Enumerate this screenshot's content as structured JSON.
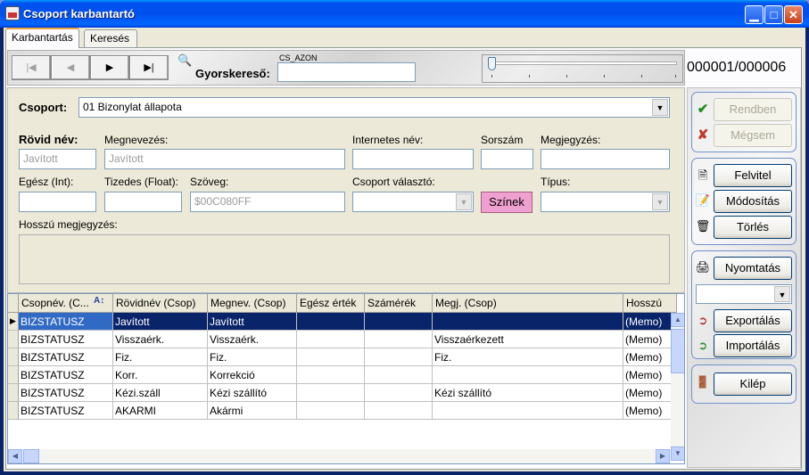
{
  "window": {
    "title": "Csoport karbantartó"
  },
  "tabs": [
    {
      "label": "Karbantartás"
    },
    {
      "label": "Keresés"
    }
  ],
  "nav": {
    "first": "|◀",
    "prev": "◀",
    "next": "▶",
    "last": "▶|",
    "quick_search_label": "Gyorskereső:",
    "quick_search_field_caption": "CS_AZON",
    "quick_search_value": "",
    "record_counter": "000001/000006"
  },
  "form": {
    "csoport_label": "Csoport:",
    "csoport_value": "01 Bizonylat állapota",
    "rovid_nev_label": "Rövid név:",
    "rovid_nev_value": "Javított",
    "megnevezes_label": "Megnevezés:",
    "megnevezes_value": "Javított",
    "internetes_nev_label": "Internetes név:",
    "internetes_nev_value": "",
    "sorszam_label": "Sorszám",
    "sorszam_value": "",
    "megjegyzes_label": "Megjegyzés:",
    "megjegyzes_value": "",
    "egesz_label": "Egész (Int):",
    "egesz_value": "",
    "tizedes_label": "Tizedes (Float):",
    "tizedes_value": "",
    "szoveg_label": "Szöveg:",
    "szoveg_value": "$00C080FF",
    "csoport_valaszto_label": "Csoport választó:",
    "csoport_valaszto_value": "",
    "szinek_label": "Színek",
    "tipus_label": "Típus:",
    "tipus_value": "",
    "hosszu_megjegyzes_label": "Hosszú megjegyzés:"
  },
  "grid": {
    "columns": [
      "Csopnév. (C...",
      "Rövidnév (Csop)",
      "Megnev. (Csop)",
      "Egész érték",
      "Számérék",
      "Megj. (Csop)",
      "Hosszú"
    ],
    "rows": [
      [
        "BIZSTATUSZ",
        "Javított",
        "Javított",
        "",
        "",
        "",
        "(Memo)"
      ],
      [
        "BIZSTATUSZ",
        "Visszaérk.",
        "Visszaérk.",
        "",
        "",
        "Visszaérkezett",
        "(Memo)"
      ],
      [
        "BIZSTATUSZ",
        "Fiz.",
        "Fiz.",
        "",
        "",
        "Fiz.",
        "(Memo)"
      ],
      [
        "BIZSTATUSZ",
        "Korr.",
        "Korrekció",
        "",
        "",
        "",
        "(Memo)"
      ],
      [
        "BIZSTATUSZ",
        "Kézi.száll",
        "Kézi szállító",
        "",
        "",
        "Kézi szállító",
        "(Memo)"
      ],
      [
        "BIZSTATUSZ",
        "AKARMI",
        "Akármi",
        "",
        "",
        "",
        "(Memo)"
      ]
    ]
  },
  "actions": {
    "rendben": "Rendben",
    "megsem": "Mégsem",
    "felvitel": "Felvitel",
    "modositas": "Módosítás",
    "torles": "Törlés",
    "nyomtatas": "Nyomtatás",
    "printer_select_value": "",
    "exportalas": "Exportálás",
    "importalas": "Importálás",
    "kilep": "Kilép"
  },
  "colors": {
    "title_bar": "#0053ee",
    "selection": "#0a246a",
    "szinek_button": "#f0a0d0"
  }
}
